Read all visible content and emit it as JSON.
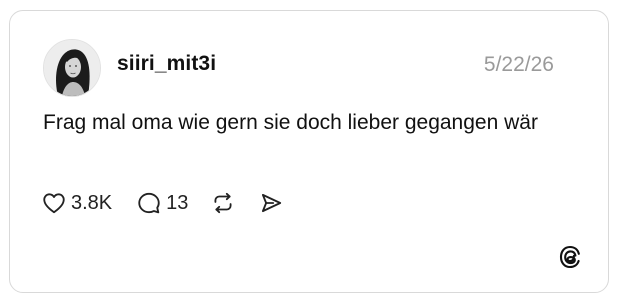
{
  "post": {
    "username": "siiri_mit3i",
    "date": "5/22/26",
    "text": "Frag mal oma wie gern sie doch lieber gegangen wär",
    "avatar_icon": "profile-photo",
    "actions": {
      "likes": "3.8K",
      "replies": "13",
      "like_icon": "heart-icon",
      "reply_icon": "speech-bubble-icon",
      "repost_icon": "repost-icon",
      "share_icon": "send-icon"
    },
    "brand_icon": "threads-logo-icon"
  }
}
